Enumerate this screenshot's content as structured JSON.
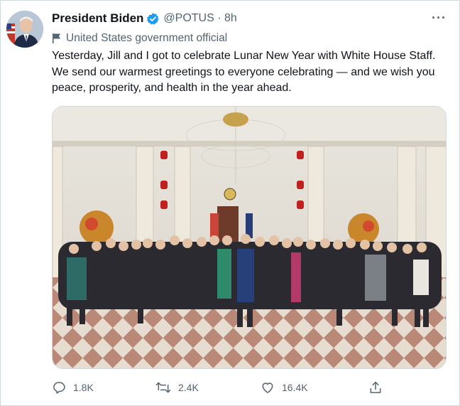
{
  "tweet": {
    "author_name": "President Biden",
    "handle_time": "@POTUS · 8h",
    "label": "United States government official",
    "text": "Yesterday, Jill and I got to celebrate Lunar New Year with White House Staff. We send our warmest greetings to everyone celebrating — and we wish you peace, prosperity, and health in the year ahead.",
    "more_label": "···"
  },
  "icons": {
    "verified": "verified-badge-icon",
    "flag": "flag-icon",
    "reply": "reply-icon",
    "retweet": "retweet-icon",
    "like": "heart-icon",
    "share": "share-icon"
  },
  "actions": {
    "replies": "1.8K",
    "retweets": "2.4K",
    "likes": "16.4K"
  },
  "colors": {
    "text_primary": "#0f1419",
    "text_secondary": "#536471",
    "verified_blue": "#1d9bf0",
    "border": "#cfd9de"
  }
}
